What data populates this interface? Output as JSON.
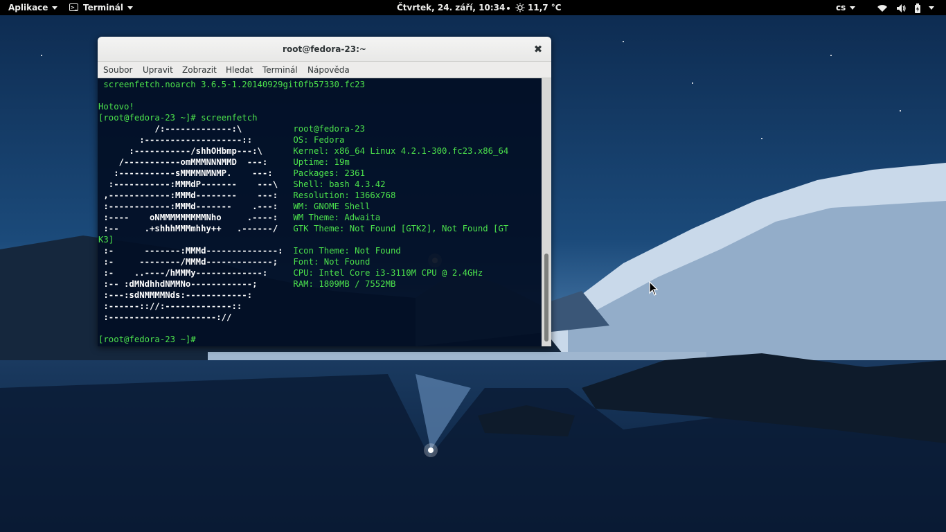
{
  "topbar": {
    "activities_label": "Aplikace",
    "app_menu_label": "Terminál",
    "clock": "Čtvrtek, 24. září, 10:34",
    "weather": "11,7 °C",
    "keyboard_layout": "cs",
    "status_icons": [
      "wifi-icon",
      "volume-icon",
      "battery-icon",
      "power-menu-icon"
    ]
  },
  "window": {
    "title": "root@fedora-23:~",
    "close_icon": "close-icon",
    "menu": [
      "Soubor",
      "Upravit",
      "Zobrazit",
      "Hledat",
      "Terminál",
      "Nápověda"
    ]
  },
  "terminal": {
    "lines": [
      " screenfetch.noarch 3.6.5-1.20140929git0fb57330.fc23",
      "",
      "Hotovo!",
      "[root@fedora-23 ~]# screenfetch",
      "           /:-------------:\\          root@fedora-23",
      "        :-------------------::        OS: Fedora",
      "      :-----------/shhOHbmp---:\\      Kernel: x86_64 Linux 4.2.1-300.fc23.x86_64",
      "    /-----------omMMMNNNMMD  ---:     Uptime: 19m",
      "   :-----------sMMMMNMNMP.    ---:    Packages: 2361",
      "  :-----------:MMMdP-------    ---\\   Shell: bash 4.3.42",
      " ,------------:MMMd--------    ---:   Resolution: 1366x768",
      " :------------:MMMd-------    .---:   WM: GNOME Shell",
      " :----    oNMMMMMMMMMNho     .----:   WM Theme: Adwaita",
      " :--     .+shhhMMMmhhy++   .------/   GTK Theme: Not Found [GTK2], Not Found [GT",
      "K3]",
      " :-      -------:MMMd--------------:  Icon Theme: Not Found",
      " :-     --------/MMMd-------------;   Font: Not Found",
      " :-    ..----/hMMMy-------------:     CPU: Intel Core i3-3110M CPU @ 2.4GHz",
      " :-- :dMNdhhdNMMNo------------;       RAM: 1809MB / 7552MB",
      " :---:sdNMMMMNds:------------:",
      " :------:://:-------------::",
      " :---------------------://",
      "",
      "[root@fedora-23 ~]# "
    ]
  },
  "colors": {
    "terminal_bg": "#020e24",
    "terminal_green": "#4ce24c",
    "terminal_white": "#ffffff",
    "topbar_bg": "#000000"
  }
}
